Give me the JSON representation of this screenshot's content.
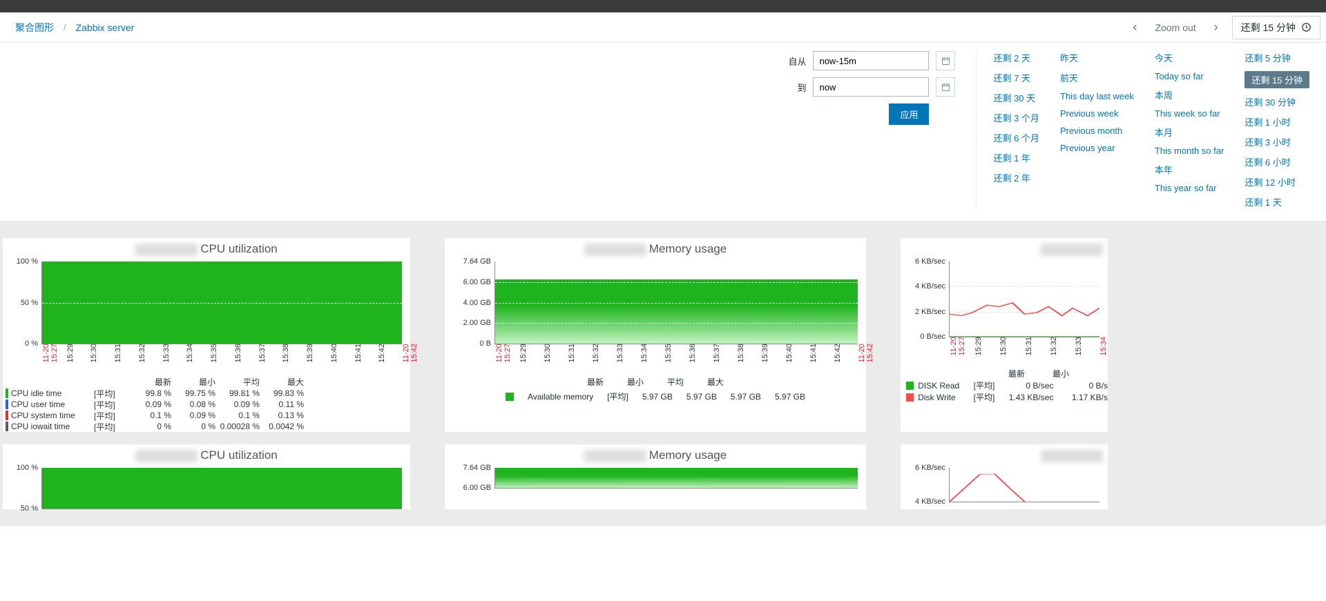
{
  "breadcrumb": {
    "parent": "聚合图形",
    "current": "Zabbix server"
  },
  "time_nav": {
    "zoom_out": "Zoom out",
    "range_label": "还剩 15 分钟"
  },
  "filter": {
    "from_label": "自从",
    "from_value": "now-15m",
    "to_label": "到",
    "to_value": "now",
    "apply": "应用"
  },
  "preset_columns": [
    [
      "还剩 2 天",
      "还剩 7 天",
      "还剩 30 天",
      "还剩 3 个月",
      "还剩 6 个月",
      "还剩 1 年",
      "还剩 2 年"
    ],
    [
      "昨天",
      "前天",
      "This day last week",
      "Previous week",
      "Previous month",
      "Previous year"
    ],
    [
      "今天",
      "Today so far",
      "本周",
      "This week so far",
      "本月",
      "This month so far",
      "本年",
      "This year so far"
    ],
    [
      "还剩 5 分钟",
      "还剩 15 分钟",
      "还剩 30 分钟",
      "还剩 1 小时",
      "还剩 3 小时",
      "还剩 6 小时",
      "还剩 12 小时",
      "还剩 1 天"
    ]
  ],
  "preset_active": "还剩 15 分钟",
  "x_ticks": [
    "11-20 15:27",
    "15:29",
    "15:30",
    "15:31",
    "15:32",
    "15:33",
    "15:34",
    "15:35",
    "15:36",
    "15:37",
    "15:38",
    "15:39",
    "15:40",
    "15:41",
    "15:42",
    "11-20 15:42"
  ],
  "x_ticks_disk": [
    "11-20 15:27",
    "15:29",
    "15:30",
    "15:31",
    "15:32",
    "15:33",
    "15:34"
  ],
  "chart_data": [
    {
      "id": "cpu1",
      "type": "area",
      "title": "CPU utilization",
      "yticks": [
        "100 %",
        "50 %",
        "0 %"
      ],
      "fill_pct": 100,
      "legend_headers": [
        "最新",
        "最小",
        "平均",
        "最大"
      ],
      "series": [
        {
          "color": "#1eb41e",
          "name": "CPU idle time",
          "agg": "[平均]",
          "vals": [
            "99.8 %",
            "99.75 %",
            "99.81 %",
            "99.83 %"
          ]
        },
        {
          "color": "#2e5fd8",
          "name": "CPU user time",
          "agg": "[平均]",
          "vals": [
            "0.09 %",
            "0.08 %",
            "0.09 %",
            "0.11 %"
          ]
        },
        {
          "color": "#d8312e",
          "name": "CPU system time",
          "agg": "[平均]",
          "vals": [
            "0.1 %",
            "0.09 %",
            "0.1 %",
            "0.13 %"
          ]
        },
        {
          "color": "#5c5c5c",
          "name": "CPU iowait time",
          "agg": "[平均]",
          "vals": [
            "0 %",
            "0 %",
            "0.00028 %",
            "0.0042 %"
          ]
        }
      ]
    },
    {
      "id": "mem1",
      "type": "area",
      "title": "Memory usage",
      "yticks": [
        "7.64 GB",
        "6.00 GB",
        "4.00 GB",
        "2.00 GB",
        "0 B"
      ],
      "fill_pct": 78,
      "legend_headers": [
        "最新",
        "最小",
        "平均",
        "最大"
      ],
      "series": [
        {
          "color": "#1eb41e",
          "name": "Available memory",
          "agg": "[平均]",
          "vals": [
            "5.97 GB",
            "5.97 GB",
            "5.97 GB",
            "5.97 GB"
          ]
        }
      ]
    },
    {
      "id": "disk1",
      "type": "line",
      "title": "",
      "yticks": [
        "6 KB/sec",
        "4 KB/sec",
        "2 KB/sec",
        "0 B/sec"
      ],
      "legend_headers": [
        "最新",
        "最小"
      ],
      "series": [
        {
          "color": "#1eb41e",
          "name": "DISK Read",
          "agg": "[平均]",
          "vals": [
            "0 B/sec",
            "0 B/s"
          ]
        },
        {
          "color": "#f14c4c",
          "name": "Disk Write",
          "agg": "[平均]",
          "vals": [
            "1.43 KB/sec",
            "1.17 KB/s"
          ]
        }
      ],
      "lines": {
        "green": [
          [
            0,
            100
          ],
          [
            100,
            100
          ]
        ],
        "red": [
          [
            0,
            70
          ],
          [
            8,
            72
          ],
          [
            15,
            68
          ],
          [
            25,
            58
          ],
          [
            33,
            60
          ],
          [
            42,
            55
          ],
          [
            50,
            70
          ],
          [
            58,
            68
          ],
          [
            66,
            60
          ],
          [
            75,
            72
          ],
          [
            82,
            62
          ],
          [
            92,
            72
          ],
          [
            100,
            62
          ]
        ]
      }
    },
    {
      "id": "cpu2",
      "type": "area",
      "title": "CPU utilization",
      "yticks": [
        "100 %",
        "50 %"
      ],
      "fill_pct": 100
    },
    {
      "id": "mem2",
      "type": "area",
      "title": "Memory usage",
      "yticks": [
        "7.64 GB",
        "6.00 GB"
      ],
      "fill_pct": 100
    },
    {
      "id": "disk2",
      "type": "line",
      "title": "",
      "yticks": [
        "6 KB/sec",
        "4 KB/sec"
      ],
      "lines": {
        "red": [
          [
            0,
            100
          ],
          [
            10,
            60
          ],
          [
            20,
            20
          ],
          [
            30,
            18
          ],
          [
            40,
            60
          ],
          [
            50,
            100
          ]
        ]
      }
    }
  ]
}
